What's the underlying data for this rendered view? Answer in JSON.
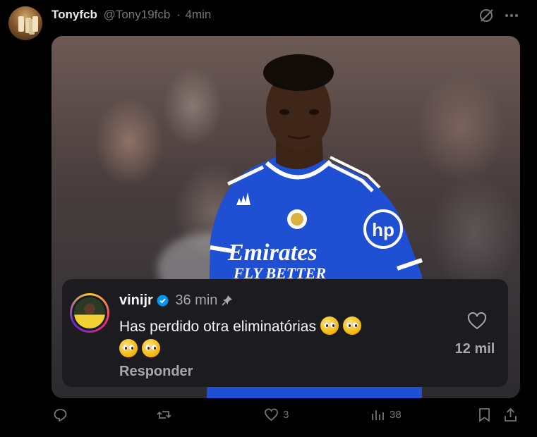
{
  "tweet": {
    "author_name": "Tonyfcb",
    "author_handle": "@Tony19fcb",
    "separator": "·",
    "time": "4min",
    "icons": {
      "grok": "grok-icon",
      "more": "more-icon"
    }
  },
  "media": {
    "jersey_text_line1": "Emirates",
    "jersey_text_line2": "FLY BETTER",
    "sponsor_badge": "hp",
    "colors": {
      "jersey": "#1e4fd6",
      "trim": "#ffffff"
    }
  },
  "comment": {
    "username": "vinijr",
    "time": "36 min",
    "text": "Has perdido otra eliminatórias",
    "reply_label": "Responder",
    "likes": "12 mil",
    "icons": {
      "verified": "verified-icon",
      "pin": "pin-icon",
      "heart": "heart-icon"
    },
    "colors": {
      "verified": "#0095f6",
      "background": "#1c1c20"
    }
  },
  "actions": {
    "reply": {
      "icon": "reply-icon",
      "count": ""
    },
    "retweet": {
      "icon": "retweet-icon",
      "count": ""
    },
    "like": {
      "icon": "like-icon",
      "count": "3"
    },
    "views": {
      "icon": "views-icon",
      "count": "38"
    },
    "bookmark": {
      "icon": "bookmark-icon"
    },
    "share": {
      "icon": "share-icon"
    }
  }
}
